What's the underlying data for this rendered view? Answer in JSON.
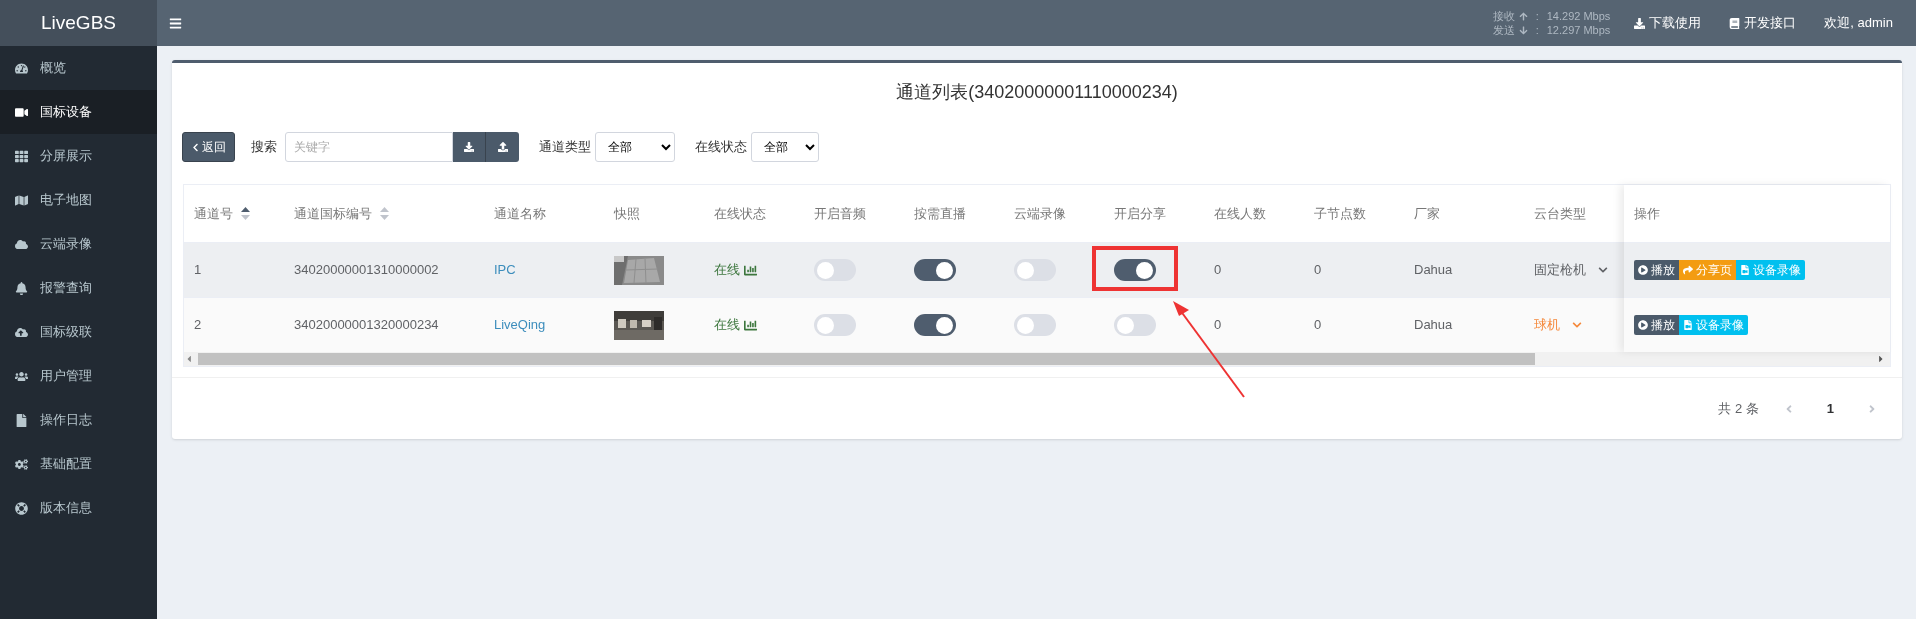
{
  "brand": "LiveGBS",
  "sidebar": {
    "items": [
      {
        "label": "概览",
        "selected": false
      },
      {
        "label": "国标设备",
        "selected": true
      },
      {
        "label": "分屏展示",
        "selected": false
      },
      {
        "label": "电子地图",
        "selected": false
      },
      {
        "label": "云端录像",
        "selected": false
      },
      {
        "label": "报警查询",
        "selected": false
      },
      {
        "label": "国标级联",
        "selected": false
      },
      {
        "label": "用户管理",
        "selected": false
      },
      {
        "label": "操作日志",
        "selected": false
      },
      {
        "label": "基础配置",
        "selected": false
      },
      {
        "label": "版本信息",
        "selected": false
      }
    ]
  },
  "topbar": {
    "rates": [
      {
        "label": "接收",
        "sep": ":",
        "value": "14.292 Mbps"
      },
      {
        "label": "发送",
        "sep": ":",
        "value": "12.297 Mbps"
      }
    ],
    "links": [
      "下载使用",
      "开发接口"
    ],
    "welcome": "欢迎, admin"
  },
  "panel": {
    "title": "通道列表(34020000001110000234)",
    "toolbar": {
      "back": "返回",
      "search_label": "搜索",
      "placeholder": "关键字",
      "filters": [
        {
          "label": "通道类型",
          "value": "全部"
        },
        {
          "label": "在线状态",
          "value": "全部"
        }
      ]
    },
    "table": {
      "columns": [
        {
          "label": "通道号",
          "sortable": true,
          "sorted": true
        },
        {
          "label": "通道国标编号",
          "sortable": true,
          "sorted": false
        },
        {
          "label": "通道名称",
          "sortable": false
        },
        {
          "label": "快照",
          "sortable": false
        },
        {
          "label": "在线状态",
          "sortable": false
        },
        {
          "label": "开启音频",
          "sortable": false
        },
        {
          "label": "按需直播",
          "sortable": false
        },
        {
          "label": "云端录像",
          "sortable": false
        },
        {
          "label": "开启分享",
          "sortable": false
        },
        {
          "label": "在线人数",
          "sortable": false
        },
        {
          "label": "子节点数",
          "sortable": false
        },
        {
          "label": "厂家",
          "sortable": false
        },
        {
          "label": "云台类型",
          "sortable": false
        }
      ],
      "actions_heading": "操作",
      "rows": [
        {
          "highlighted": true,
          "cells": [
            {
              "kind": "text",
              "text": "1"
            },
            {
              "kind": "text",
              "text": "34020000001310000002"
            },
            {
              "kind": "link",
              "text": "IPC"
            },
            {
              "kind": "snapshot"
            },
            {
              "kind": "status",
              "text": "在线"
            },
            {
              "kind": "toggle",
              "on": false
            },
            {
              "kind": "toggle",
              "on": true
            },
            {
              "kind": "toggle",
              "on": false
            },
            {
              "kind": "toggle",
              "on": true
            },
            {
              "kind": "text",
              "text": "0"
            },
            {
              "kind": "text",
              "text": "0"
            },
            {
              "kind": "text",
              "text": "Dahua"
            },
            {
              "kind": "select",
              "text": "固定枪机",
              "color": "#606266"
            }
          ],
          "actions": [
            {
              "kind": "play",
              "label": "播放"
            },
            {
              "kind": "share",
              "label": "分享页"
            },
            {
              "kind": "record",
              "label": "设备录像"
            }
          ]
        },
        {
          "highlighted": false,
          "cells": [
            {
              "kind": "text",
              "text": "2"
            },
            {
              "kind": "text",
              "text": "34020000001320000234"
            },
            {
              "kind": "link",
              "text": "LiveQing"
            },
            {
              "kind": "snapshot"
            },
            {
              "kind": "status",
              "text": "在线"
            },
            {
              "kind": "toggle",
              "on": false
            },
            {
              "kind": "toggle",
              "on": true
            },
            {
              "kind": "toggle",
              "on": false
            },
            {
              "kind": "toggle",
              "on": false
            },
            {
              "kind": "text",
              "text": "0"
            },
            {
              "kind": "text",
              "text": "0"
            },
            {
              "kind": "text",
              "text": "Dahua"
            },
            {
              "kind": "select",
              "text": "球机",
              "color": "#f5883a"
            }
          ],
          "actions": [
            {
              "kind": "play",
              "label": "播放"
            },
            {
              "kind": "record",
              "label": "设备录像"
            }
          ]
        }
      ]
    },
    "pagination": {
      "total": "共 2 条",
      "pages": [
        {
          "label": "1",
          "selected": true
        }
      ]
    }
  }
}
